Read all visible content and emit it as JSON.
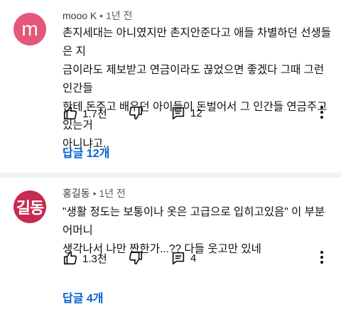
{
  "comments": [
    {
      "avatar_letter": "m",
      "author": "mooo K",
      "separator": "•",
      "time": "1년 전",
      "text_lines": [
        "촌지세대는 아니였지만 촌지안준다고 애들 차별하던 선생들은 지",
        "금이라도 제보받고 연금이라도 끊었으면 좋겠다 그때 그런 인간들",
        "한테 돈주고 배우던 아이들이 돈벌어서 그 인간들 연금주고있는거",
        "아니냐고.."
      ],
      "likes": "1.7천",
      "reply_count": "12",
      "replies_link": "답글 12개"
    },
    {
      "avatar_letter": "길동",
      "author": "홍길동",
      "separator": "•",
      "time": "1년 전",
      "text_lines": [
        "\"생활 정도는 보통이나 옷은 고급으로 입히고있음\" 이 부분 어머니",
        "생각나서 나만 짠한가...?? 다들 웃고만 있네"
      ],
      "likes": "1.3천",
      "reply_count": "4",
      "replies_link": "답글 4개"
    }
  ],
  "icons": [
    "thumb-up-icon",
    "thumb-down-icon",
    "reply-icon",
    "more-vert-icon"
  ],
  "colors": {
    "link": "#065fd4",
    "avatar1": "#e4577a",
    "avatar2": "#c92a4f",
    "divider": "#f2f2f2"
  }
}
